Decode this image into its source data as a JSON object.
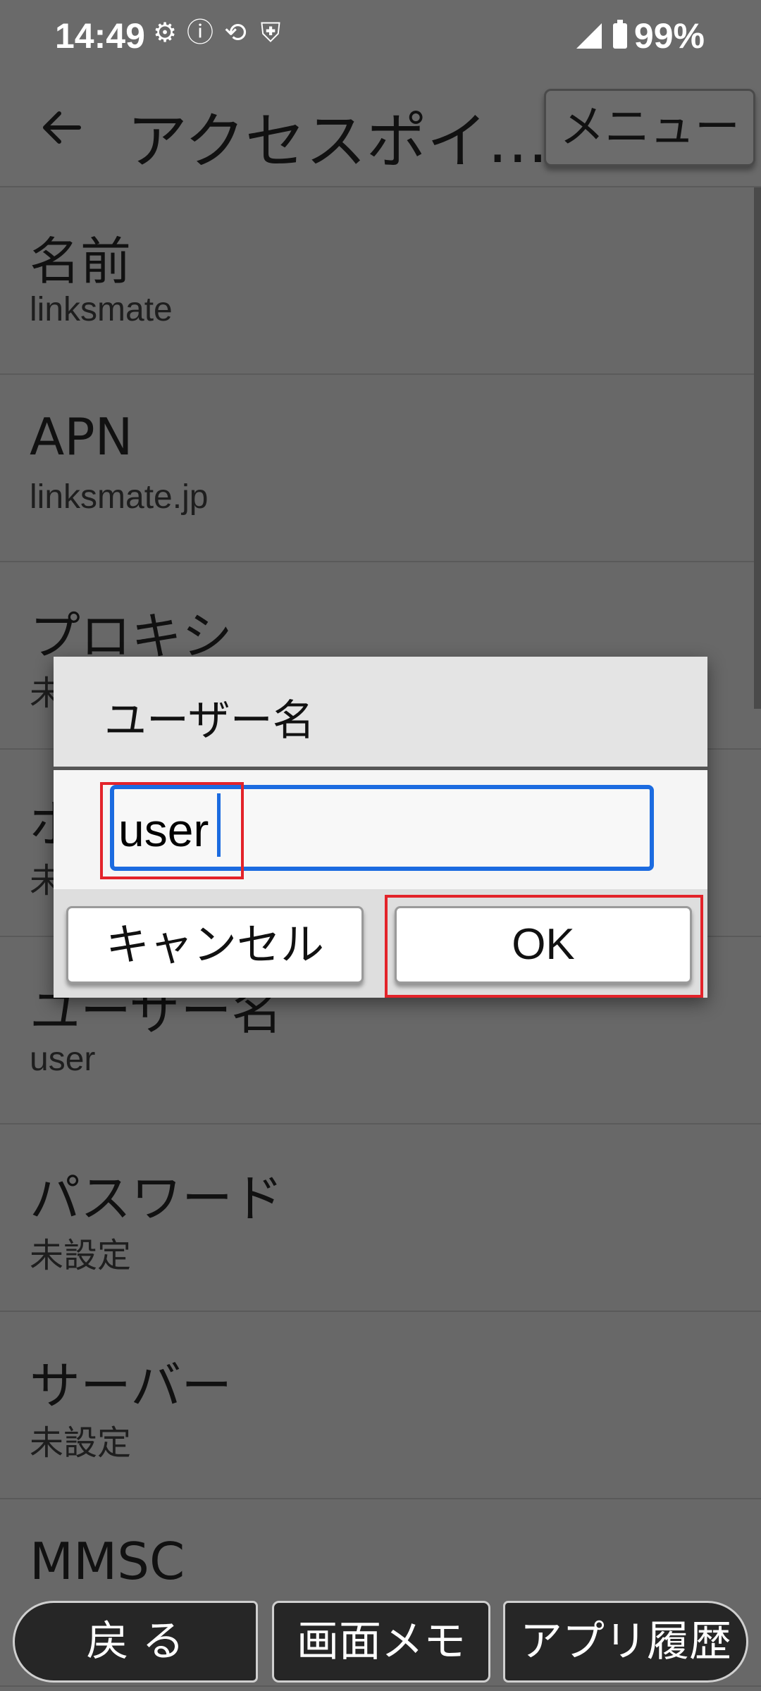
{
  "status_bar": {
    "time": "14:49",
    "left_icons": [
      "settings-icon",
      "info-icon",
      "screen-rotate-icon",
      "shield-icon"
    ],
    "battery": "99%"
  },
  "app_bar": {
    "title": "アクセスポイ…",
    "menu_label": "メニュー"
  },
  "settings": [
    {
      "title": "名前",
      "value": "linksmate"
    },
    {
      "title": "APN",
      "value": "linksmate.jp"
    },
    {
      "title": "プロキシ",
      "value": "未"
    },
    {
      "title": "ポ",
      "value": "未"
    },
    {
      "title": "ユーザー名",
      "value": "user"
    },
    {
      "title": "パスワード",
      "value": "未設定"
    },
    {
      "title": "サーバー",
      "value": "未設定"
    },
    {
      "title": "MMSC",
      "value": ""
    }
  ],
  "dialog": {
    "title": "ユーザー名",
    "input_value": "user",
    "cancel_label": "キャンセル",
    "ok_label": "OK"
  },
  "nav": {
    "back_label": "戻 る",
    "memo_label": "画面メモ",
    "history_label": "アプリ履歴"
  },
  "colors": {
    "highlight": "#e3232a",
    "input_focus": "#1b6be0",
    "scrim": "#686868"
  }
}
